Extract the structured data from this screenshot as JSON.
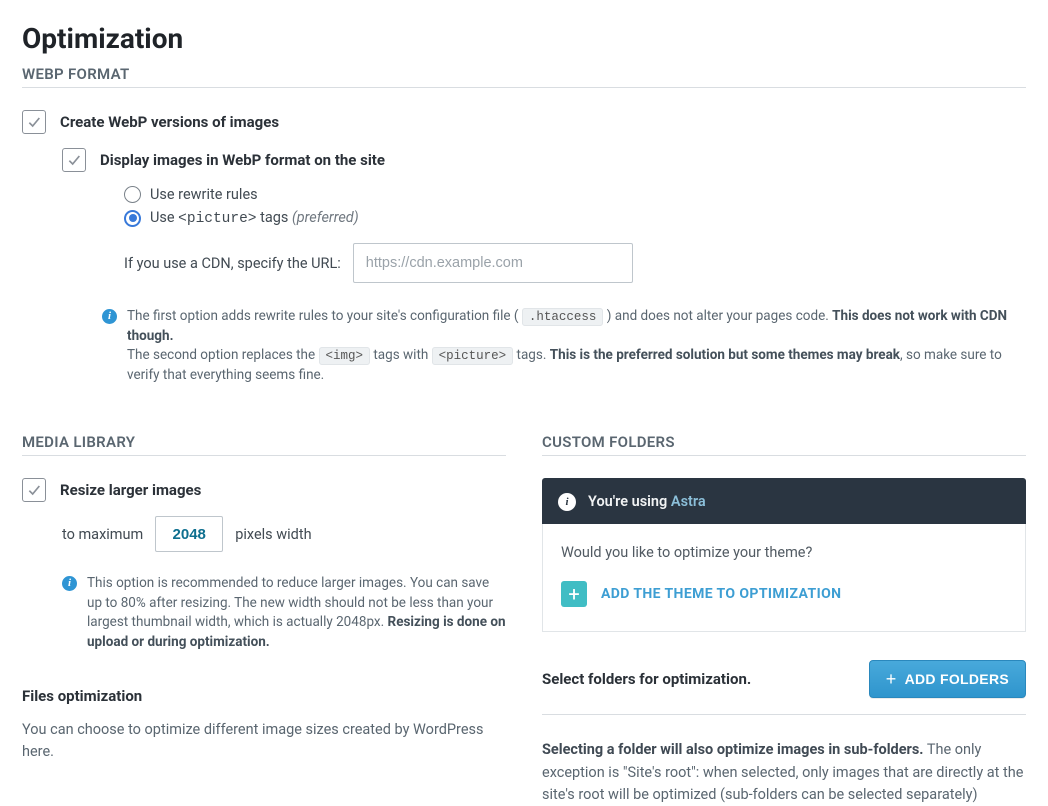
{
  "page": {
    "title": "Optimization"
  },
  "webp": {
    "section_label": "WEBP FORMAT",
    "create_label": "Create WebP versions of images",
    "display_label": "Display images in WebP format on the site",
    "radio_rewrite": "Use rewrite rules",
    "radio_picture_prefix": "Use ",
    "radio_picture_code": "<picture>",
    "radio_picture_suffix": " tags ",
    "radio_picture_pref": "(preferred)",
    "cdn_label": "If you use a CDN, specify the URL:",
    "cdn_placeholder": "https://cdn.example.com",
    "info": {
      "l1a": "The first option adds rewrite rules to your site's configuration file ( ",
      "l1_code": ".htaccess",
      "l1b": " ) and does not alter your pages code. ",
      "l1_strong": "This does not work with CDN though.",
      "l2a": "The second option replaces the ",
      "l2_code1": "<img>",
      "l2b": " tags with ",
      "l2_code2": "<picture>",
      "l2c": " tags. ",
      "l2_strong": "This is the preferred solution but some themes may break",
      "l2d": ", so make sure to verify that everything seems fine."
    }
  },
  "media": {
    "section_label": "MEDIA LIBRARY",
    "resize_label": "Resize larger images",
    "to_max": "to maximum",
    "px_value": "2048",
    "px_suffix": "pixels width",
    "info_a": "This option is recommended to reduce larger images. You can save up to 80% after resizing. The new width should not be less than your largest thumbnail width, which is actually 2048px. ",
    "info_strong": "Resizing is done on upload or during optimization."
  },
  "files": {
    "heading": "Files optimization",
    "p1": "You can choose to optimize different image sizes created by WordPress here."
  },
  "custom": {
    "section_label": "CUSTOM FOLDERS",
    "banner_prefix": "You're using ",
    "banner_brand": "Astra",
    "question": "Would you like to optimize your theme?",
    "add_theme": "ADD THE THEME TO OPTIMIZATION",
    "select_label": "Select folders for optimization.",
    "add_btn": "ADD FOLDERS",
    "desc_strong": "Selecting a folder will also optimize images in sub-folders.",
    "desc_rest": " The only exception is \"Site's root\": when selected, only images that are directly at the site's root will be optimized (sub-folders can be selected separately)"
  }
}
